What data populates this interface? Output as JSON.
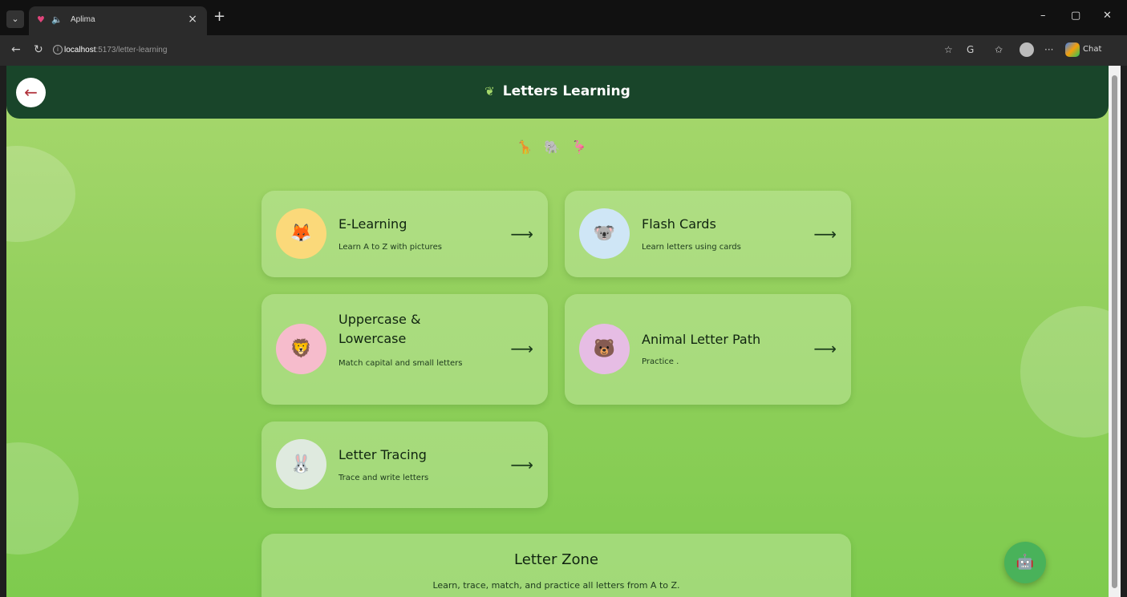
{
  "browser": {
    "tab_title": "Aplima",
    "tab_close": "×",
    "new_tab": "+",
    "url_host": "localhost",
    "url_path": ":5173/letter-learning",
    "chat_label": "Chat",
    "window_buttons": [
      "–",
      "▢",
      "✕"
    ]
  },
  "header": {
    "back_label": "←",
    "sprout": "❦",
    "title": "Letters Learning"
  },
  "emoji_row": [
    "🦒",
    "🐘",
    "🦩"
  ],
  "cards": [
    {
      "title": "E-Learning",
      "desc": "Learn A to Z with pictures",
      "icon": "fox-icon",
      "glyph": "🦊",
      "bg": "#fbd97a",
      "arrow": "⟶"
    },
    {
      "title": "Flash Cards",
      "desc": "Learn letters using cards",
      "icon": "koala-icon",
      "glyph": "🐨",
      "bg": "#cfe6f6",
      "arrow": "⟶"
    },
    {
      "title": "Uppercase & Lowercase",
      "desc": "Match capital and small letters",
      "icon": "lion-icon",
      "glyph": "🦁",
      "bg": "#f6bccc",
      "arrow": "⟶"
    },
    {
      "title": "Animal Letter Path",
      "desc": "Practice .",
      "icon": "bear-icon",
      "glyph": "🐻",
      "bg": "#e6bde4",
      "arrow": "⟶"
    },
    {
      "title": "Letter Tracing",
      "desc": "Trace and write letters",
      "icon": "bunny-icon",
      "glyph": "🐰",
      "bg": "#dfeadf",
      "arrow": "⟶"
    }
  ],
  "zone": {
    "title": "Letter Zone",
    "desc": "Learn, trace, match, and practice all letters from A to Z."
  },
  "fab_glyph": "🤖"
}
